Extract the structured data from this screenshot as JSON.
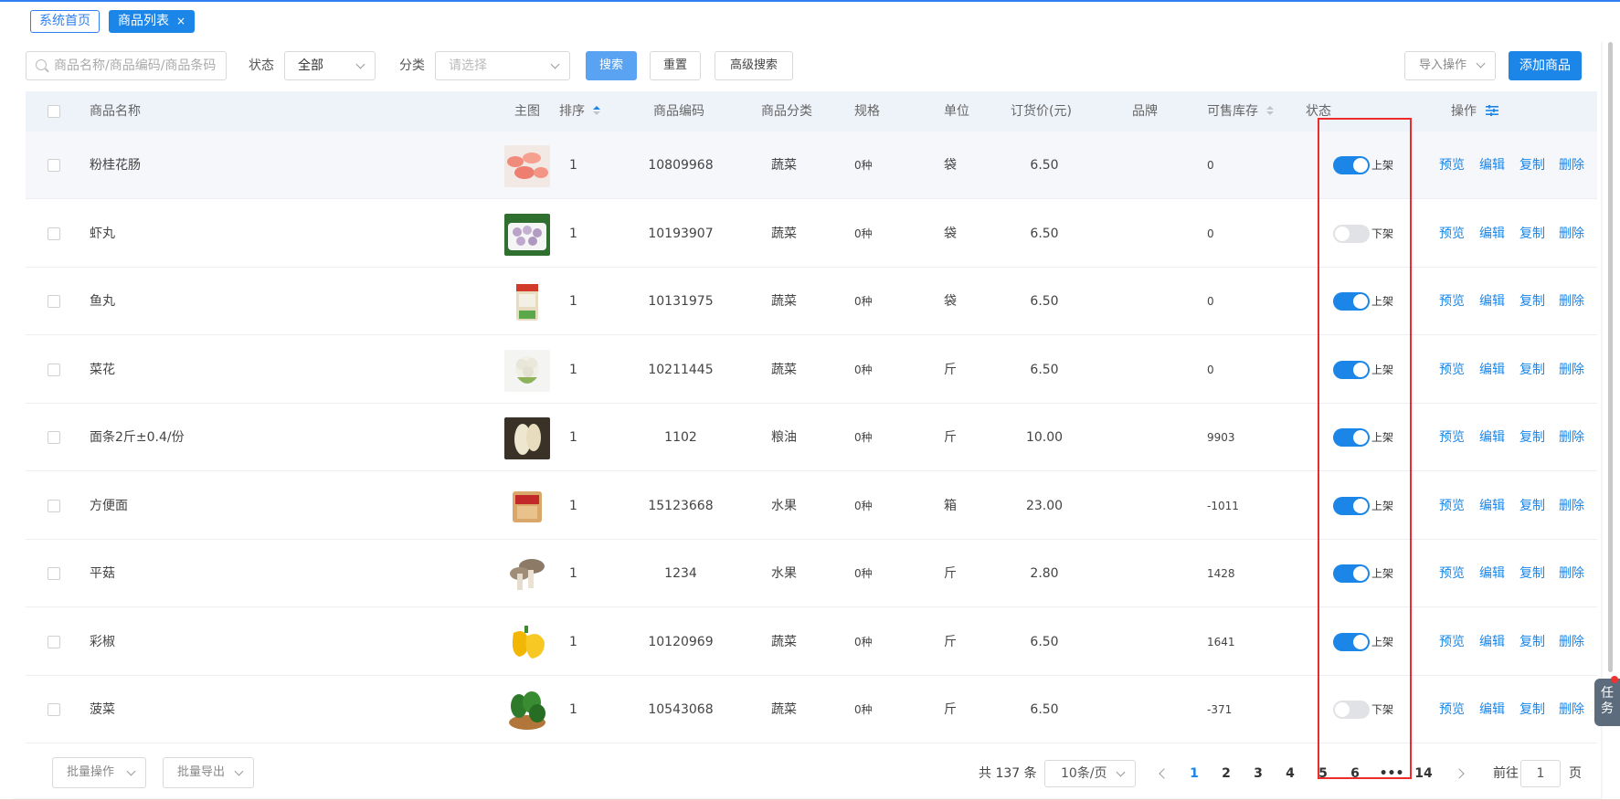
{
  "tabs": [
    {
      "label": "系统首页",
      "active": false
    },
    {
      "label": "商品列表",
      "active": true,
      "close": "×"
    }
  ],
  "toolbar": {
    "search_placeholder": "商品名称/商品编码/商品条码",
    "status_label": "状态",
    "status_value": "全部",
    "category_label": "分类",
    "category_placeholder": "请选择",
    "search_btn": "搜索",
    "reset_btn": "重置",
    "advanced_btn": "高级搜索",
    "import_btn": "导入操作",
    "add_btn": "添加商品"
  },
  "columns": {
    "name": "商品名称",
    "image": "主图",
    "sort": "排序",
    "code": "商品编码",
    "category": "商品分类",
    "spec": "规格",
    "unit": "单位",
    "price": "订货价(元)",
    "brand": "品牌",
    "stock": "可售库存",
    "status": "状态",
    "ops": "操作"
  },
  "rows": [
    {
      "name": "粉桂花肠",
      "sort": "1",
      "code": "10809968",
      "category": "蔬菜",
      "spec": "0种",
      "unit": "袋",
      "price": "6.50",
      "stock": "0",
      "on": true,
      "status": "上架"
    },
    {
      "name": "虾丸",
      "sort": "1",
      "code": "10193907",
      "category": "蔬菜",
      "spec": "0种",
      "unit": "袋",
      "price": "6.50",
      "stock": "0",
      "on": false,
      "status": "下架"
    },
    {
      "name": "鱼丸",
      "sort": "1",
      "code": "10131975",
      "category": "蔬菜",
      "spec": "0种",
      "unit": "袋",
      "price": "6.50",
      "stock": "0",
      "on": true,
      "status": "上架"
    },
    {
      "name": "菜花",
      "sort": "1",
      "code": "10211445",
      "category": "蔬菜",
      "spec": "0种",
      "unit": "斤",
      "price": "6.50",
      "stock": "0",
      "on": true,
      "status": "上架"
    },
    {
      "name": "面条2斤±0.4/份",
      "sort": "1",
      "code": "1102",
      "category": "粮油",
      "spec": "0种",
      "unit": "斤",
      "price": "10.00",
      "stock": "9903",
      "on": true,
      "status": "上架"
    },
    {
      "name": "方便面",
      "sort": "1",
      "code": "15123668",
      "category": "水果",
      "spec": "0种",
      "unit": "箱",
      "price": "23.00",
      "stock": "-1011",
      "on": true,
      "status": "上架"
    },
    {
      "name": "平菇",
      "sort": "1",
      "code": "1234",
      "category": "水果",
      "spec": "0种",
      "unit": "斤",
      "price": "2.80",
      "stock": "1428",
      "on": true,
      "status": "上架"
    },
    {
      "name": "彩椒",
      "sort": "1",
      "code": "10120969",
      "category": "蔬菜",
      "spec": "0种",
      "unit": "斤",
      "price": "6.50",
      "stock": "1641",
      "on": true,
      "status": "上架"
    },
    {
      "name": "菠菜",
      "sort": "1",
      "code": "10543068",
      "category": "蔬菜",
      "spec": "0种",
      "unit": "斤",
      "price": "6.50",
      "stock": "-371",
      "on": false,
      "status": "下架"
    }
  ],
  "actions": {
    "preview": "预览",
    "edit": "编辑",
    "copy": "复制",
    "delete": "删除"
  },
  "footer": {
    "batch_ops": "批量操作",
    "batch_export": "批量导出",
    "total": "共 137 条",
    "page_size": "10条/页",
    "pages": [
      "1",
      "2",
      "3",
      "4",
      "5",
      "6",
      "•••",
      "14"
    ],
    "current_page": "1",
    "goto_label": "前往",
    "goto_value": "1",
    "page_suffix": "页"
  },
  "task_button": "任务",
  "colors": {
    "accent": "#1b86e8",
    "highlight_box": "#ee2b2b"
  }
}
